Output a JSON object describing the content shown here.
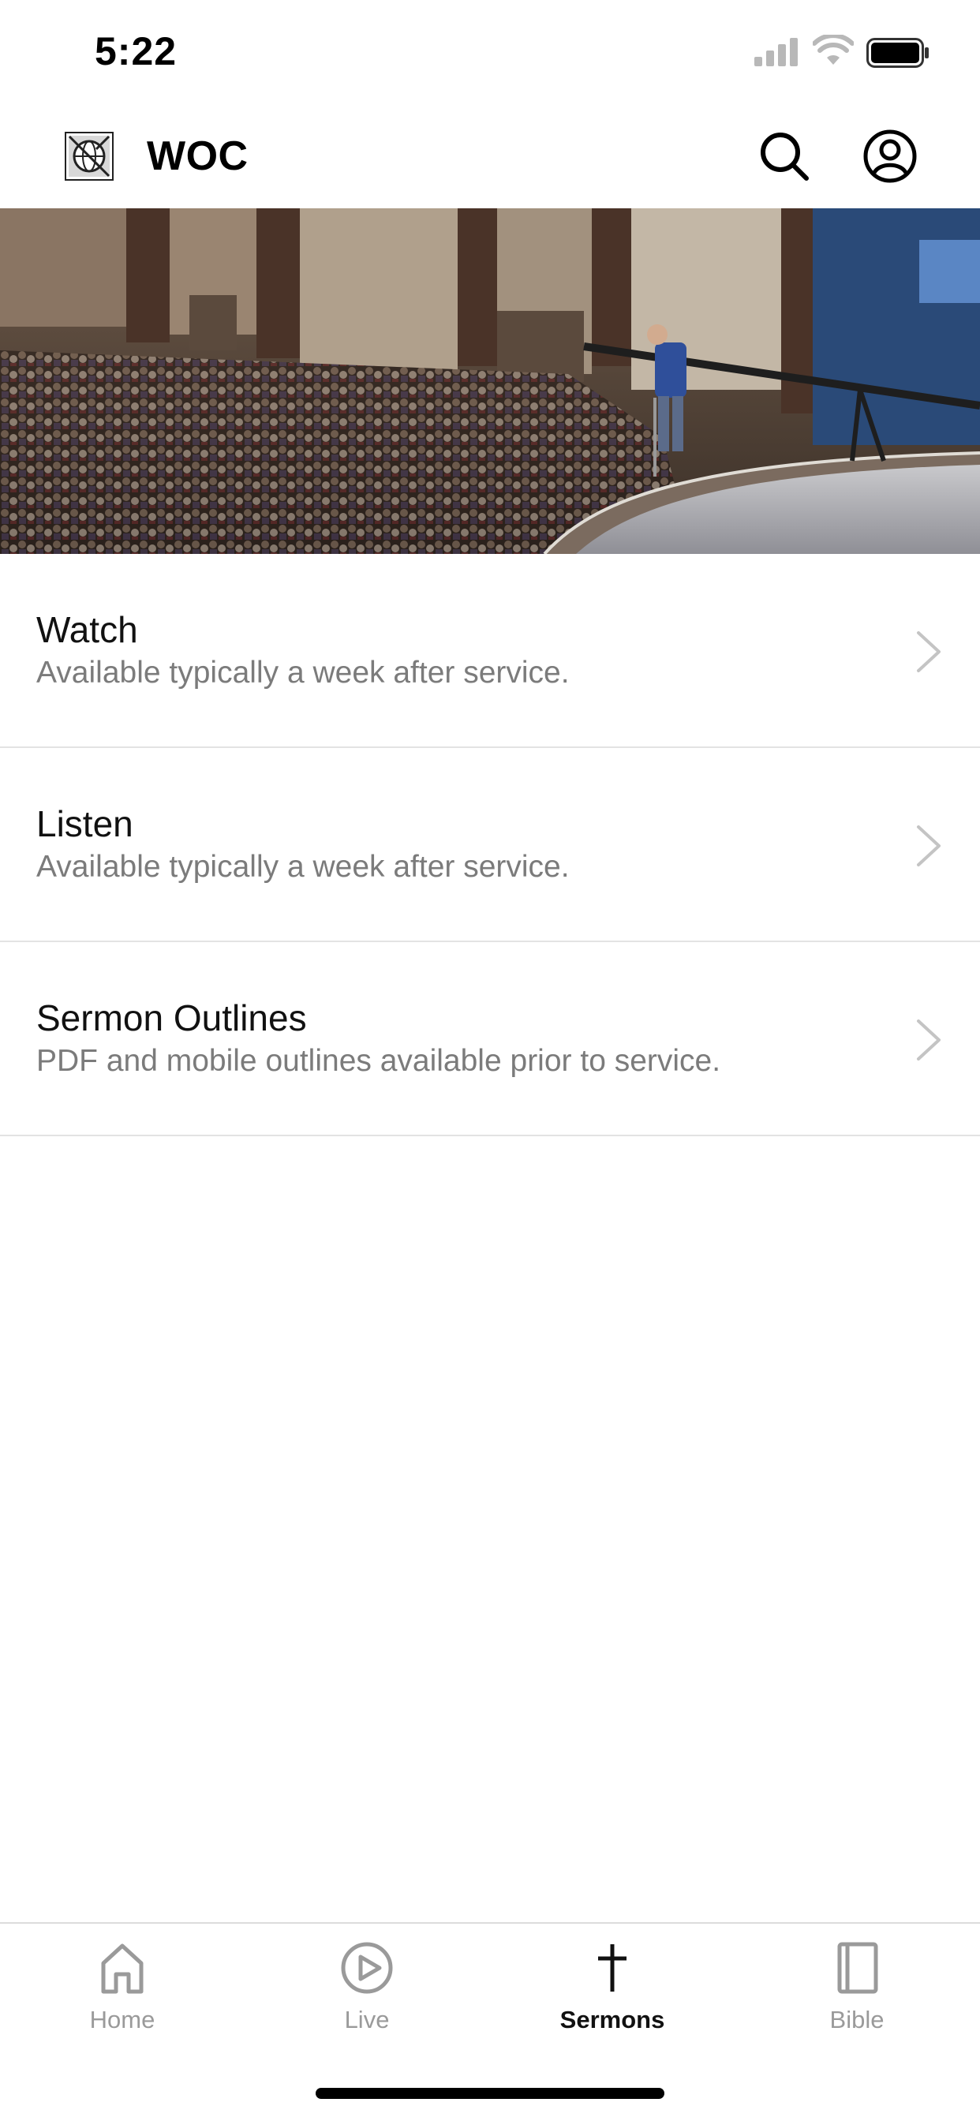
{
  "status_bar": {
    "time": "5:22"
  },
  "header": {
    "title": "WOC",
    "logo": "globe-logo",
    "search_icon": "search-icon",
    "account_icon": "account-icon"
  },
  "hero": {
    "image": "sanctuary-congregation-photo"
  },
  "menu": {
    "items": [
      {
        "title": "Watch",
        "subtitle": "Available typically a week after service."
      },
      {
        "title": "Listen",
        "subtitle": "Available typically a week after service."
      },
      {
        "title": "Sermon Outlines",
        "subtitle": "PDF and mobile outlines available prior to service."
      }
    ]
  },
  "tabs": {
    "items": [
      {
        "label": "Home",
        "icon": "home-icon"
      },
      {
        "label": "Live",
        "icon": "play-circle-icon"
      },
      {
        "label": "Sermons",
        "icon": "cross-icon"
      },
      {
        "label": "Bible",
        "icon": "book-icon"
      }
    ],
    "active": "Sermons"
  },
  "colors": {
    "subtitle": "#7b7b7b",
    "tab_inactive": "#9a9a9a",
    "tab_active": "#111111",
    "divider": "#e3e3e3"
  }
}
